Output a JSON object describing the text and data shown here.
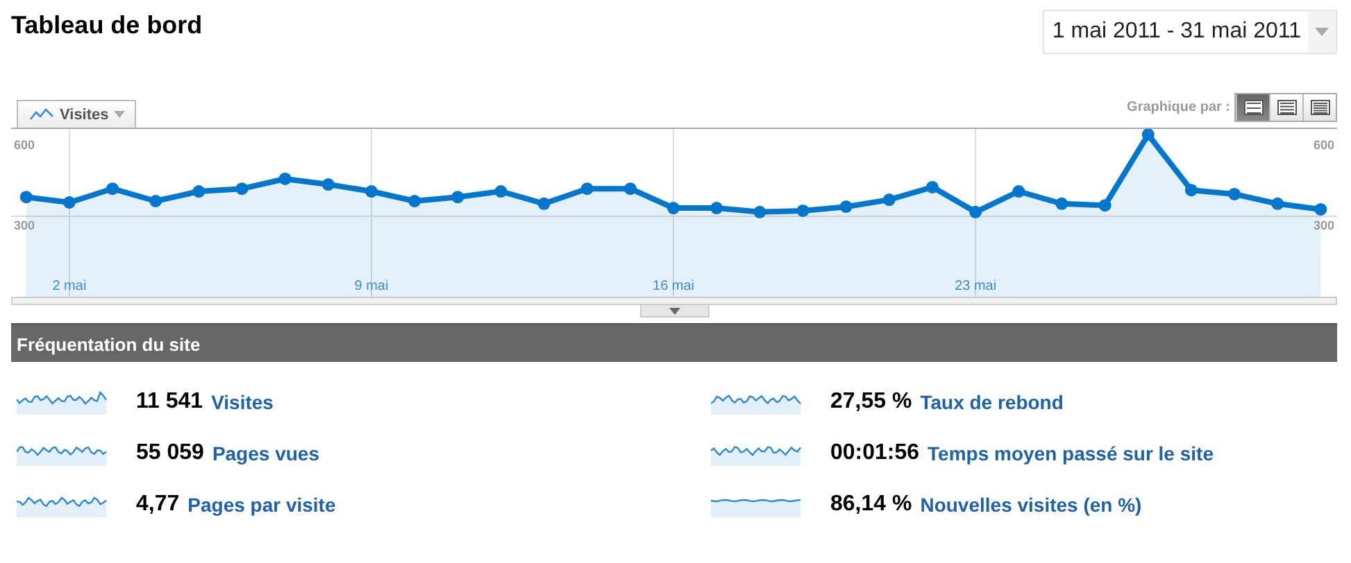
{
  "title": "Tableau de bord",
  "date_range": {
    "value": "1 mai 2011 - 31 mai 2011"
  },
  "chart": {
    "graph_by_label": "Graphique par :",
    "left_axis_labels": [
      "600",
      "300"
    ],
    "right_axis_labels": [
      "600",
      "300"
    ],
    "view_buttons": [
      {
        "selected": true
      },
      {
        "selected": false
      },
      {
        "selected": false
      }
    ],
    "chart_data": {
      "type": "area",
      "xlim": [
        0.65,
        31.38
      ],
      "x": [
        1,
        2,
        3,
        4,
        5,
        6,
        7,
        8,
        9,
        10,
        11,
        12,
        13,
        14,
        15,
        16,
        17,
        18,
        19,
        20,
        21,
        22,
        23,
        24,
        25,
        26,
        27,
        28,
        29,
        30,
        31
      ],
      "series": [
        {
          "name": "Visites",
          "color": "#0077cc",
          "values": [
            403,
            383,
            434,
            388,
            424,
            434,
            471,
            450,
            424,
            388,
            403,
            424,
            378,
            434,
            434,
            362,
            362,
            347,
            352,
            367,
            393,
            440,
            347,
            424,
            378,
            372,
            636,
            429,
            414,
            378,
            357
          ]
        }
      ],
      "ylim": [
        31,
        657
      ],
      "yticks": [
        300,
        600
      ],
      "grid": true,
      "xticks": [
        {
          "value": 2,
          "label": "2 mai"
        },
        {
          "value": 9,
          "label": "9 mai"
        },
        {
          "value": 16,
          "label": "16 mai"
        },
        {
          "value": 23,
          "label": "23 mai"
        }
      ]
    }
  },
  "section": {
    "title": "Fréquentation du site",
    "metrics": [
      {
        "value": "11 541",
        "label": "Visites"
      },
      {
        "value": "27,55 %",
        "label": "Taux de rebond"
      },
      {
        "value": "55 059",
        "label": "Pages vues"
      },
      {
        "value": "00:01:56",
        "label": "Temps moyen passé sur le site"
      },
      {
        "value": "4,77",
        "label": "Pages par visite"
      },
      {
        "value": "86,14 %",
        "label": "Nouvelles visites (en %)"
      }
    ]
  }
}
